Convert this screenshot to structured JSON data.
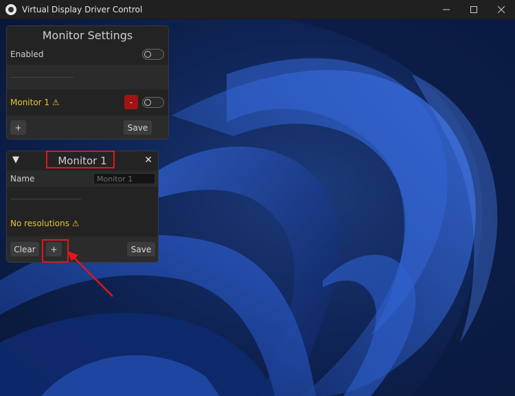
{
  "window": {
    "title": "Virtual Display Driver Control",
    "minimize": "–",
    "maximize": "☐",
    "close": "✕"
  },
  "monitor_settings": {
    "title": "Monitor Settings",
    "enabled_label": "Enabled",
    "enabled": false,
    "monitor_label": "Monitor 1",
    "warning_symbol": "⚠",
    "remove_label": "-",
    "monitor_enabled": false,
    "add_label": "+",
    "save_label": "Save"
  },
  "monitor_panel": {
    "collapse_symbol": "▼",
    "title": "Monitor 1",
    "close_symbol": "✕",
    "name_label": "Name",
    "name_value": "Monitor 1",
    "no_resolutions_label": "No resolutions",
    "warning_symbol": "⚠",
    "clear_label": "Clear",
    "add_label": "+",
    "save_label": "Save"
  },
  "colors": {
    "title_bar": "#202020",
    "panel_bg": "#232323",
    "warning": "#e8c53a",
    "remove_button": "#a01414",
    "highlight": "#e01818",
    "wallpaper": "#0b1730"
  }
}
